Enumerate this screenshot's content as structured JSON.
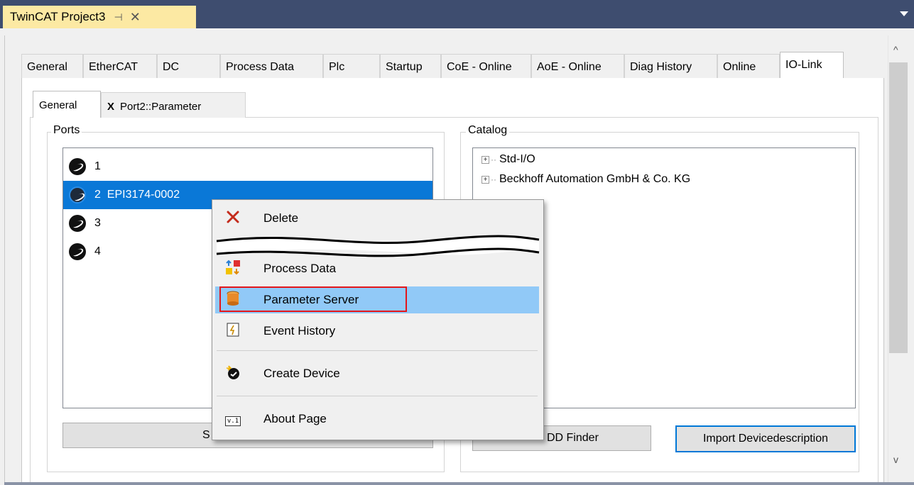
{
  "window": {
    "doc_tab_title": "TwinCAT Project3",
    "pin_glyph": "⊣",
    "close_glyph": "✕",
    "scroll_up_glyph": "^",
    "scroll_down_glyph": "v"
  },
  "main_tabs": [
    {
      "label": "General"
    },
    {
      "label": "EtherCAT"
    },
    {
      "label": "DC"
    },
    {
      "label": "Process Data"
    },
    {
      "label": "Plc"
    },
    {
      "label": "Startup"
    },
    {
      "label": "CoE - Online"
    },
    {
      "label": "AoE - Online"
    },
    {
      "label": "Diag History"
    },
    {
      "label": "Online"
    },
    {
      "label": "IO-Link",
      "active": true
    }
  ],
  "sub_tabs": [
    {
      "label": "General",
      "active": true
    },
    {
      "label": "Port2::Parameter",
      "close_glyph": "X"
    }
  ],
  "ports": {
    "group_label": "Ports",
    "items": [
      {
        "label": "1"
      },
      {
        "label": "2  EPI3174-0002",
        "selected": true
      },
      {
        "label": "3"
      },
      {
        "label": "4"
      }
    ],
    "button_label": "Settings",
    "button_label_visible": "S"
  },
  "catalog": {
    "group_label": "Catalog",
    "items": [
      {
        "label": "Std-I/O"
      },
      {
        "label": "Beckhoff Automation GmbH & Co. KG"
      }
    ],
    "buttons": {
      "iodd_finder": "IODD Finder",
      "iodd_finder_visible": "DD Finder",
      "import": "Import Devicedescription"
    }
  },
  "context_menu": {
    "items": [
      {
        "label": "Delete",
        "icon": "delete-icon"
      },
      {
        "label": "Process Data",
        "icon": "process-data-icon"
      },
      {
        "label": "Parameter Server",
        "icon": "parameter-server-icon",
        "highlighted": true
      },
      {
        "label": "Event History",
        "icon": "event-history-icon"
      },
      {
        "label": "Create Device",
        "icon": "create-device-icon"
      },
      {
        "label": "About Page",
        "icon": "about-page-icon",
        "icon_text": "v.1"
      }
    ]
  },
  "colors": {
    "title_bar": "#3e4d6f",
    "doc_tab": "#fce9a3",
    "selection": "#0a78d7",
    "menu_highlight": "#91c9f7",
    "callout_box": "#e3151a",
    "default_button_border": "#0078d7"
  }
}
